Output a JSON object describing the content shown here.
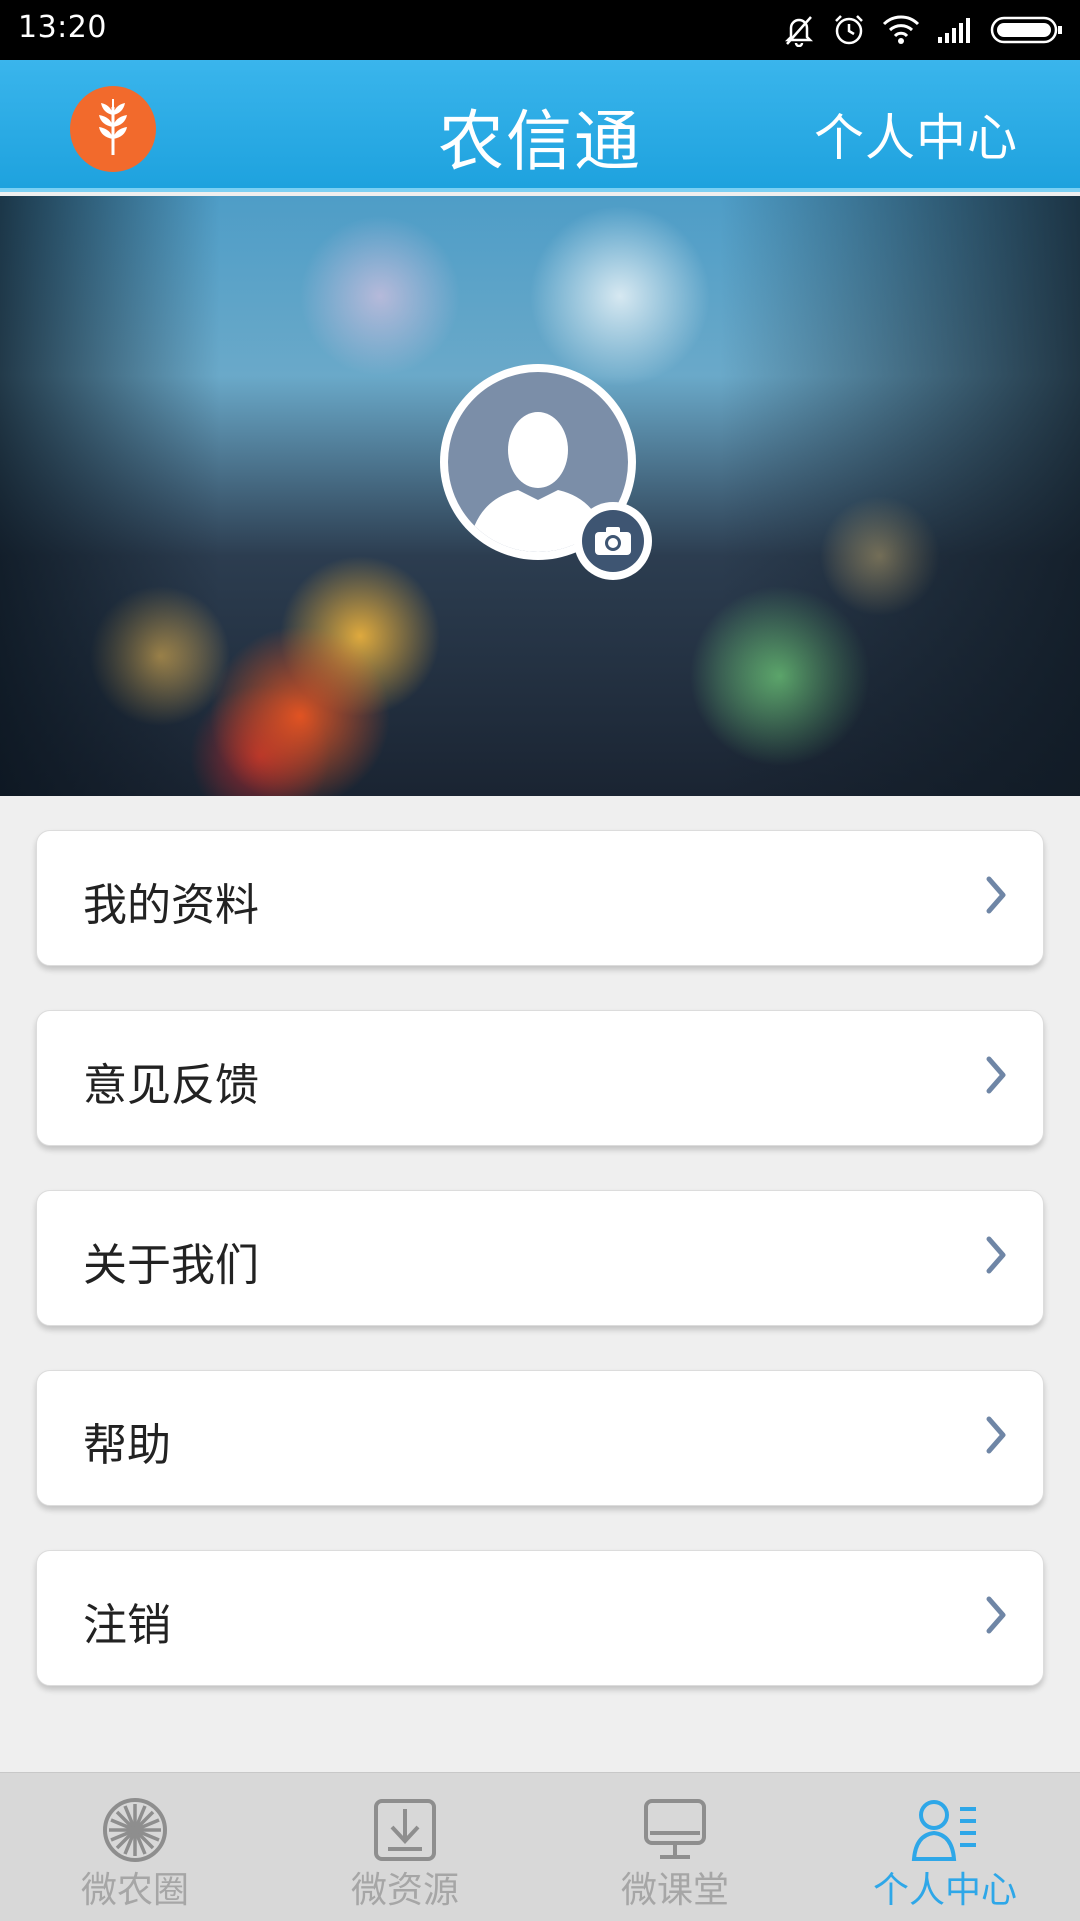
{
  "status_bar": {
    "time": "13:20",
    "icons": [
      "bell-muted-icon",
      "alarm-icon",
      "wifi-icon",
      "signal-icon",
      "battery-icon"
    ]
  },
  "app_bar": {
    "title": "农信通",
    "page_title": "个人中心",
    "logo_icon": "wheat-icon",
    "color": "#27aae3",
    "logo_color": "#f26a2c"
  },
  "profile": {
    "avatar_icon": "avatar-placeholder-icon",
    "camera_icon": "camera-icon"
  },
  "menu": {
    "items": [
      {
        "label": "我的资料"
      },
      {
        "label": "意见反馈"
      },
      {
        "label": "关于我们"
      },
      {
        "label": "帮助"
      },
      {
        "label": "注销"
      }
    ]
  },
  "bottom_nav": {
    "items": [
      {
        "label": "微农圈",
        "icon": "aperture-icon",
        "active": false
      },
      {
        "label": "微资源",
        "icon": "download-icon",
        "active": false
      },
      {
        "label": "微课堂",
        "icon": "monitor-icon",
        "active": false
      },
      {
        "label": "个人中心",
        "icon": "profile-list-icon",
        "active": true
      }
    ],
    "active_color": "#2ea7e8",
    "inactive_color": "#a6a6a6"
  }
}
